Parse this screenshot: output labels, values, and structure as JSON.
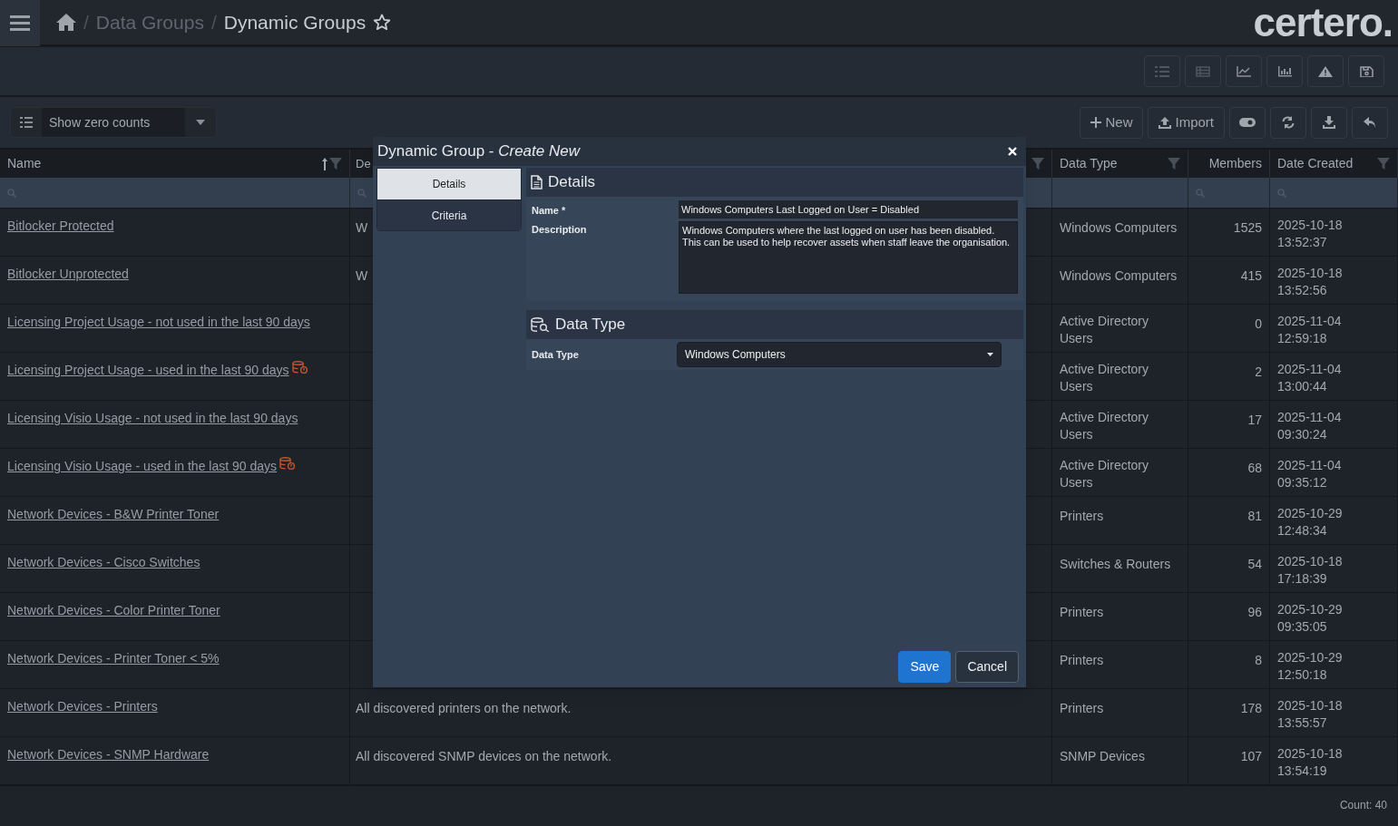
{
  "breadcrumb": [
    {
      "separator": "/",
      "label": "Data Groups",
      "current": false
    },
    {
      "separator": "/",
      "label": "Dynamic Groups",
      "current": true
    }
  ],
  "logo": "certero.",
  "view_filter": {
    "value": "Show zero counts"
  },
  "actions": [
    {
      "kind": "new",
      "label": "New"
    },
    {
      "kind": "import",
      "label": "Import"
    }
  ],
  "table": {
    "columns": [
      {
        "label": "Name",
        "sorted": true,
        "filter": true,
        "searchable": true
      },
      {
        "label": "De",
        "sorted": false,
        "filter": true,
        "searchable": true
      },
      {
        "label": "Data Type",
        "sorted": false,
        "filter": true,
        "searchable": false
      },
      {
        "label": "Members",
        "sorted": false,
        "filter": false,
        "searchable": true
      },
      {
        "label": "Date Created",
        "sorted": false,
        "filter": true,
        "searchable": true
      }
    ],
    "rows": [
      {
        "name": "Bitlocker Protected",
        "warning": false,
        "description": "W",
        "data_type": "Windows Computers",
        "members": "1525",
        "created": "2025-10-18 13:52:37"
      },
      {
        "name": "Bitlocker Unprotected",
        "warning": false,
        "description": "W",
        "data_type": "Windows Computers",
        "members": "415",
        "created": "2025-10-18 13:52:56"
      },
      {
        "name": "Licensing Project Usage - not used in the last 90 days",
        "warning": false,
        "data_type": "Active Directory Users",
        "members": "0",
        "created": "2025-11-04 12:59:18"
      },
      {
        "name": "Licensing Project Usage - used in the last 90 days",
        "warning": true,
        "data_type": "Active Directory Users",
        "members": "2",
        "created": "2025-11-04 13:00:44"
      },
      {
        "name": "Licensing Visio Usage - not used in the last 90 days",
        "warning": false,
        "data_type": "Active Directory Users",
        "members": "17",
        "created": "2025-11-04 09:30:24"
      },
      {
        "name": "Licensing Visio Usage - used in the last 90 days",
        "warning": true,
        "data_type": "Active Directory Users",
        "members": "68",
        "created": "2025-11-04 09:35:12"
      },
      {
        "name": "Network Devices - B&W Printer Toner",
        "warning": false,
        "data_type": "Printers",
        "members": "81",
        "created": "2025-10-29 12:48:34"
      },
      {
        "name": "Network Devices - Cisco Switches",
        "warning": false,
        "data_type": "Switches & Routers",
        "members": "54",
        "created": "2025-10-18 17:18:39"
      },
      {
        "name": "Network Devices - Color Printer Toner",
        "warning": false,
        "data_type": "Printers",
        "members": "96",
        "created": "2025-10-29 09:35:05"
      },
      {
        "name": "Network Devices - Printer Toner < 5%",
        "warning": false,
        "data_type": "Printers",
        "members": "8",
        "created": "2025-10-29 12:50:18"
      },
      {
        "name": "Network Devices - Printers",
        "warning": false,
        "description": "All discovered printers on the network.",
        "data_type": "Printers",
        "members": "178",
        "created": "2025-10-18 13:55:57"
      },
      {
        "name": "Network Devices - SNMP Hardware",
        "warning": false,
        "description": "All discovered SNMP devices on the network.",
        "data_type": "SNMP Devices",
        "members": "107",
        "created": "2025-10-18 13:54:19"
      }
    ]
  },
  "count": "Count: 40",
  "dialog": {
    "title": "Dynamic Group - *Create New*",
    "tabs": [
      {
        "label": "Details",
        "selected": true
      },
      {
        "label": "Criteria",
        "selected": false
      }
    ],
    "details_heading": "Details",
    "name_label": "Name *",
    "name_value": "Windows Computers Last Logged on User = Disabled",
    "description_label": "Description",
    "description_value": "Windows Computers where the last logged on user has been disabled. This can be used to help recover assets when staff leave the organisation.",
    "data_type_heading": "Data Type",
    "data_type_label": "Data Type",
    "data_type_value": "Windows Computers",
    "buttons": [
      {
        "kind": "primary",
        "label": "Save"
      },
      {
        "kind": "secondary",
        "label": "Cancel"
      }
    ]
  }
}
